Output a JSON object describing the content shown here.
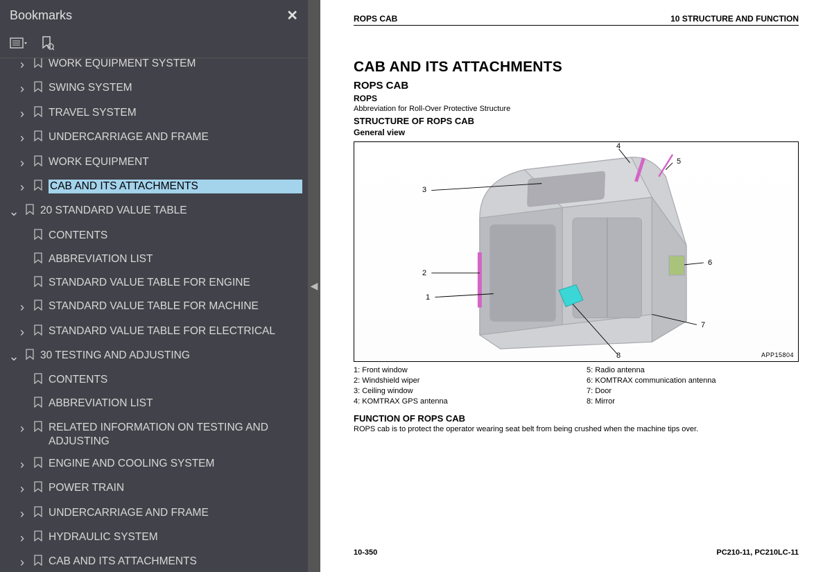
{
  "sidebar": {
    "title": "Bookmarks",
    "close": "✕",
    "items": [
      {
        "indent": 0,
        "chev": "r",
        "label": "WORK EQUIPMENT SYSTEM",
        "cut": true
      },
      {
        "indent": 0,
        "chev": "r",
        "label": "SWING SYSTEM"
      },
      {
        "indent": 0,
        "chev": "r",
        "label": "TRAVEL SYSTEM"
      },
      {
        "indent": 0,
        "chev": "r",
        "label": "UNDERCARRIAGE AND FRAME"
      },
      {
        "indent": 0,
        "chev": "r",
        "label": "WORK EQUIPMENT"
      },
      {
        "indent": 0,
        "chev": "r",
        "label": "CAB AND ITS ATTACHMENTS",
        "selected": true
      },
      {
        "indent": -1,
        "chev": "d",
        "label": "20 STANDARD VALUE TABLE"
      },
      {
        "indent": 0,
        "chev": "",
        "label": "CONTENTS"
      },
      {
        "indent": 0,
        "chev": "",
        "label": "ABBREVIATION LIST"
      },
      {
        "indent": 0,
        "chev": "",
        "label": "STANDARD VALUE TABLE FOR ENGINE"
      },
      {
        "indent": 0,
        "chev": "r",
        "label": "STANDARD VALUE TABLE FOR MACHINE"
      },
      {
        "indent": 0,
        "chev": "r",
        "label": "STANDARD VALUE TABLE FOR ELECTRICAL"
      },
      {
        "indent": -1,
        "chev": "d",
        "label": "30 TESTING AND ADJUSTING"
      },
      {
        "indent": 0,
        "chev": "",
        "label": "CONTENTS"
      },
      {
        "indent": 0,
        "chev": "",
        "label": "ABBREVIATION LIST"
      },
      {
        "indent": 0,
        "chev": "r",
        "label": "RELATED INFORMATION ON TESTING AND ADJUSTING"
      },
      {
        "indent": 0,
        "chev": "r",
        "label": "ENGINE AND COOLING SYSTEM"
      },
      {
        "indent": 0,
        "chev": "r",
        "label": "POWER TRAIN"
      },
      {
        "indent": 0,
        "chev": "r",
        "label": "UNDERCARRIAGE AND FRAME"
      },
      {
        "indent": 0,
        "chev": "r",
        "label": "HYDRAULIC SYSTEM"
      },
      {
        "indent": 0,
        "chev": "r",
        "label": "CAB AND ITS ATTACHMENTS"
      }
    ]
  },
  "collapse_glyph": "◀",
  "doc": {
    "header_left": "ROPS CAB",
    "header_right": "10 STRUCTURE AND FUNCTION",
    "h1": "CAB AND ITS ATTACHMENTS",
    "h2": "ROPS CAB",
    "h3": "ROPS",
    "abbrev": "Abbreviation for Roll-Over Protective Structure",
    "h2b": "STRUCTURE OF ROPS CAB",
    "h3b": "General view",
    "fig_id": "APP15804",
    "callouts": [
      "1",
      "2",
      "3",
      "4",
      "5",
      "6",
      "7",
      "8"
    ],
    "legend_left": [
      "1: Front window",
      "2: Windshield wiper",
      "3: Ceiling window",
      "4: KOMTRAX GPS antenna"
    ],
    "legend_right": [
      "5: Radio antenna",
      "6: KOMTRAX communication antenna",
      "7: Door",
      "8: Mirror"
    ],
    "func_h": "FUNCTION OF ROPS CAB",
    "func_t": "ROPS cab is to protect the operator wearing seat belt from being crushed when the machine tips over.",
    "footer_left": "10-350",
    "footer_right": "PC210-11, PC210LC-11"
  }
}
